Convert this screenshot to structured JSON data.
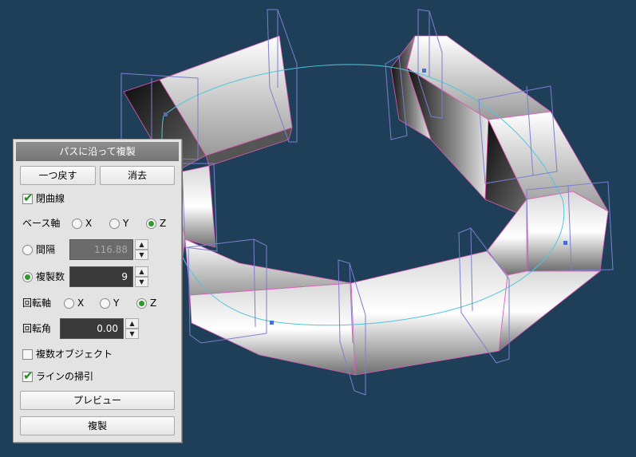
{
  "dialog": {
    "title": "パスに沿って複製",
    "undo_label": "一つ戻す",
    "delete_label": "消去",
    "closed_curve_label": "閉曲線",
    "closed_curve_checked": true,
    "base_axis_label": "ベース軸",
    "base_axis_options": [
      "X",
      "Y",
      "Z"
    ],
    "base_axis_selected": "Z",
    "spacing_label": "間隔",
    "spacing_value": "116.88",
    "count_label": "複製数",
    "count_value": "9",
    "rot_axis_label": "回転軸",
    "rot_axis_options": [
      "X",
      "Y",
      "Z"
    ],
    "rot_axis_selected": "Z",
    "rot_angle_label": "回転角",
    "rot_angle_value": "0.00",
    "multi_object_label": "複数オブジェクト",
    "multi_object_checked": false,
    "sweep_label": "ラインの掃引",
    "sweep_checked": true,
    "preview_label": "プレビュー",
    "duplicate_label": "複製"
  },
  "colors": {
    "background": "#1f3f58",
    "path_line": "#4fc6dc",
    "edge_highlight": "#e05bb7",
    "frame_lines": "#7b7fd0",
    "radio_selected": "#2f9b2f",
    "check_mark": "#1b8e1b"
  }
}
